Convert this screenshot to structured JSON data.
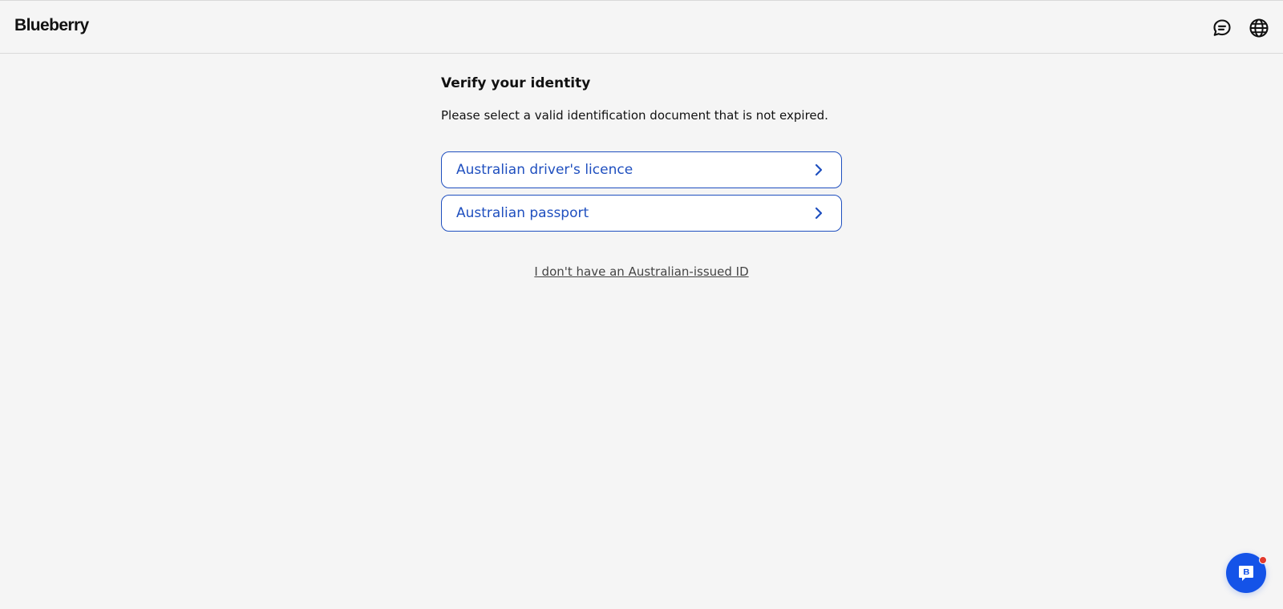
{
  "header": {
    "logo_text": "Blueberry",
    "icons": [
      "chat-bubble-icon",
      "globe-icon"
    ]
  },
  "main": {
    "title": "Verify your identity",
    "subtitle": "Please select a valid identification document that is not expired.",
    "options": [
      {
        "label": "Australian driver's licence",
        "icon": "chevron-right-icon"
      },
      {
        "label": "Australian passport",
        "icon": "chevron-right-icon"
      }
    ],
    "no_id_link": "I don't have an Australian-issued ID"
  },
  "chat_widget": {
    "icon": "chat-widget-icon",
    "badge": "notification-dot",
    "colors": {
      "button": "#1453e8",
      "dot": "#e23b2e"
    }
  },
  "colors": {
    "background": "#f5f5f5",
    "accent": "#1f4fbf",
    "text": "#111111"
  }
}
